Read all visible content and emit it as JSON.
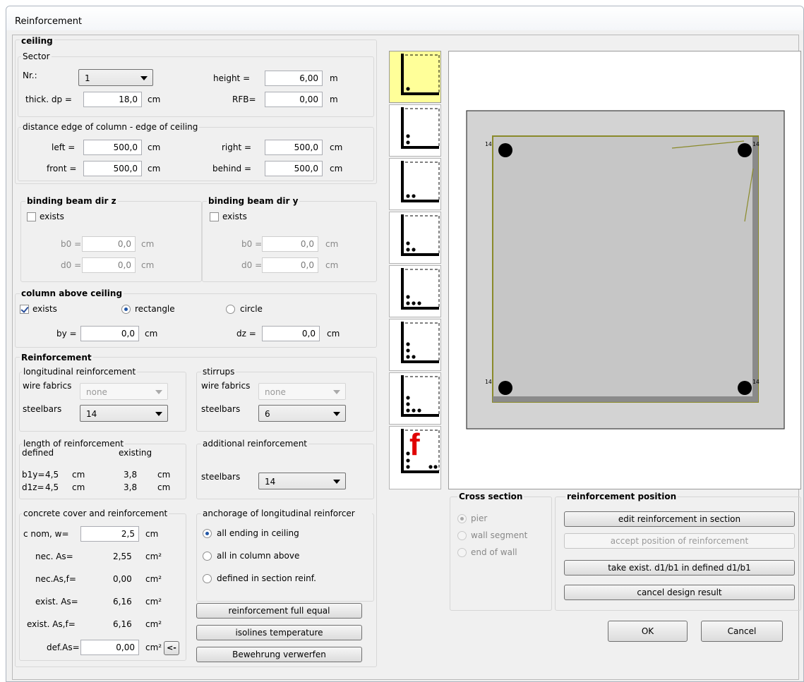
{
  "window": {
    "title": "Reinforcement"
  },
  "ceiling": {
    "title": "ceiling",
    "sector_title": "Sector",
    "nr_label": "Nr.:",
    "nr_value": "1",
    "height_label": "height =",
    "height_value": "6,00",
    "height_unit": "m",
    "thick_label": "thick. dp =",
    "thick_value": "18,0",
    "thick_unit": "cm",
    "rfb_label": "RFB=",
    "rfb_value": "0,00",
    "rfb_unit": "m",
    "distance_title": "distance edge of column - edge of ceiling",
    "left_label": "left  =",
    "left_value": "500,0",
    "right_label": "right  =",
    "right_value": "500,0",
    "front_label": "front  =",
    "front_value": "500,0",
    "behind_label": "behind  =",
    "behind_value": "500,0",
    "unit_cm": "cm"
  },
  "binding_beam_z": {
    "title": "binding beam dir z",
    "exists_label": "exists",
    "exists": false,
    "b0_label": "b0 =",
    "b0_value": "0,0",
    "d0_label": "d0 =",
    "d0_value": "0,0",
    "unit": "cm"
  },
  "binding_beam_y": {
    "title": "binding beam dir y",
    "exists_label": "exists",
    "exists": false,
    "b0_label": "b0 =",
    "b0_value": "0,0",
    "d0_label": "d0 =",
    "d0_value": "0,0",
    "unit": "cm"
  },
  "column_above": {
    "title": "column above ceiling",
    "exists_label": "exists",
    "exists": true,
    "rectangle_label": "rectangle",
    "circle_label": "circle",
    "shape": "rectangle",
    "by_label": "by =",
    "by_value": "0,0",
    "dz_label": "dz =",
    "dz_value": "0,0",
    "unit": "cm"
  },
  "reinforcement": {
    "title": "Reinforcement",
    "longitudinal": {
      "title": "longitudinal reinforcement",
      "wire_label": "wire fabrics",
      "wire_value": "none",
      "steel_label": "steelbars",
      "steel_value": "14"
    },
    "stirrups": {
      "title": "stirrups",
      "wire_label": "wire fabrics",
      "wire_value": "none",
      "steel_label": "steelbars",
      "steel_value": "6"
    },
    "length": {
      "title": "length of reinforcement",
      "defined_label": "defined",
      "existing_label": "existing",
      "b1y_label": "b1y=",
      "b1y_def": "4,5",
      "b1y_exist": "3,8",
      "d1z_label": "d1z=",
      "d1z_def": "4,5",
      "d1z_exist": "3,8",
      "unit": "cm"
    },
    "additional": {
      "title": "additional reinforcement",
      "steel_label": "steelbars",
      "steel_value": "14"
    },
    "cover": {
      "title": "concrete cover and reinforcement",
      "cnom_label": "c nom, w=",
      "cnom_value": "2,5",
      "cnom_unit": "cm",
      "nec_as_label": "nec. As=",
      "nec_as_value": "2,55",
      "nec_asf_label": "nec.As,f=",
      "nec_asf_value": "0,00",
      "exist_as_label": "exist. As=",
      "exist_as_value": "6,16",
      "exist_asf_label": "exist. As,f=",
      "exist_asf_value": "6,16",
      "def_as_label": "def.As=",
      "def_as_value": "0,00",
      "unit_area": "cm²",
      "arrow_button": "<-"
    },
    "anchorage": {
      "title": "anchorage of longitudinal reinforcer",
      "opt1": "all ending in ceiling",
      "opt2": "all in column above",
      "opt3": "defined in section reinf.",
      "selected": "all ending in ceiling"
    }
  },
  "buttons": {
    "full_equal": "reinforcement full equal",
    "isolines": "isolines temperature",
    "verwerfen": "Bewehrung verwerfen",
    "edit_section": "edit reinforcement in section",
    "accept_position": "accept position of reinforcement",
    "take_exist": "take exist. d1/b1 in defined d1/b1",
    "cancel_design": "cancel design result",
    "ok": "OK",
    "cancel": "Cancel"
  },
  "cross_section": {
    "title": "Cross section",
    "opt_pier": "pier",
    "opt_wall": "wall segment",
    "opt_end": "end of wall",
    "selected": "pier"
  },
  "position": {
    "title": "reinforcement position"
  },
  "preview": {
    "bar_labels": [
      "14",
      "14",
      "14",
      "14"
    ],
    "thumbnail_count": 8,
    "selected_thumbnail": 1,
    "thumb_f_letter": "f",
    "color_fill": "#d3d3d3",
    "color_outline": "#8a8a2a"
  }
}
